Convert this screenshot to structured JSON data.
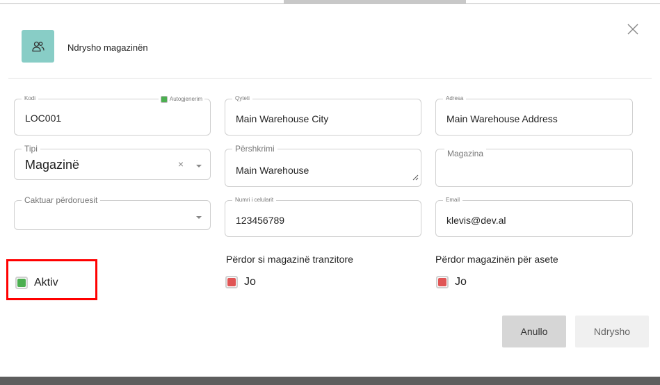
{
  "dialog": {
    "title": "Ndrysho magazinën"
  },
  "form": {
    "kodi": {
      "label": "Kodi",
      "value": "LOC001",
      "autogen_label": "Autogjenerim"
    },
    "qyteti": {
      "label": "Qyteti",
      "value": "Main Warehouse City"
    },
    "adresa": {
      "label": "Adresa",
      "value": "Main Warehouse Address"
    },
    "tipi": {
      "label": "Tipi",
      "value": "Magazinë"
    },
    "pershkrimi": {
      "label": "Përshkrimi",
      "value": "Main Warehouse"
    },
    "magazina": {
      "label": "Magazina",
      "value": ""
    },
    "caktuar": {
      "label": "Caktuar përdoruesit",
      "value": ""
    },
    "celulari": {
      "label": "Numri i celularit",
      "value": "123456789"
    },
    "email": {
      "label": "Email",
      "value": "klevis@dev.al"
    }
  },
  "checkboxes": {
    "aktiv": {
      "label": "Aktiv",
      "checked": true
    },
    "tranzitore": {
      "group_label": "Përdor si magazinë tranzitore",
      "label": "Jo",
      "checked": false
    },
    "asete": {
      "group_label": "Përdor magazinën për asete",
      "label": "Jo",
      "checked": false
    }
  },
  "buttons": {
    "cancel": "Anullo",
    "submit": "Ndrysho"
  },
  "colors": {
    "accent": "#88cdc6",
    "checked": "#4caf50",
    "unchecked": "#e05555",
    "highlight": "#ff0000"
  },
  "icons": {
    "header": "users-icon",
    "close": "close-icon"
  }
}
